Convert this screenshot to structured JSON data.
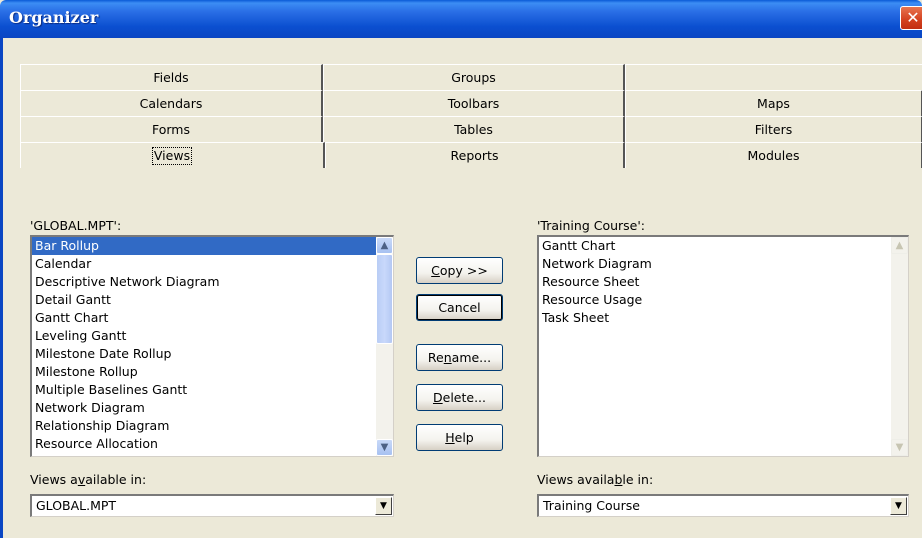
{
  "window": {
    "title": "Organizer",
    "close_icon": "close-icon"
  },
  "tabs": {
    "row1": [
      "Fields",
      "Groups",
      ""
    ],
    "row2": [
      "Calendars",
      "Toolbars",
      "Maps"
    ],
    "row3": [
      "Forms",
      "Tables",
      "Filters"
    ],
    "row4": [
      "Views",
      "Reports",
      "Modules"
    ],
    "selected": "Views"
  },
  "left": {
    "label": "'GLOBAL.MPT':",
    "items": [
      "Bar Rollup",
      "Calendar",
      "Descriptive Network Diagram",
      "Detail Gantt",
      "Gantt Chart",
      "Leveling Gantt",
      "Milestone Date Rollup",
      "Milestone Rollup",
      "Multiple Baselines Gantt",
      "Network Diagram",
      "Relationship Diagram",
      "Resource Allocation"
    ],
    "selected_item": "Bar Rollup",
    "available_label_pre": "Views a",
    "available_label_u": "v",
    "available_label_post": "ailable in:",
    "available_value": "GLOBAL.MPT"
  },
  "right": {
    "label": "'Training Course':",
    "items": [
      "Gantt Chart",
      "Network Diagram",
      "Resource Sheet",
      "Resource Usage",
      "Task Sheet"
    ],
    "available_label_pre": "Views availa",
    "available_label_u": "b",
    "available_label_post": "le in:",
    "available_value": "Training Course"
  },
  "buttons": {
    "copy": {
      "u": "C",
      "rest": "opy >>"
    },
    "cancel": "Cancel",
    "rename": {
      "pre": "Re",
      "u": "n",
      "rest": "ame..."
    },
    "delete": {
      "u": "D",
      "rest": "elete..."
    },
    "help": {
      "u": "H",
      "rest": "elp"
    }
  },
  "colors": {
    "titlebar": "#0b4fd0",
    "selection": "#316ac5",
    "face": "#ece9d8"
  }
}
